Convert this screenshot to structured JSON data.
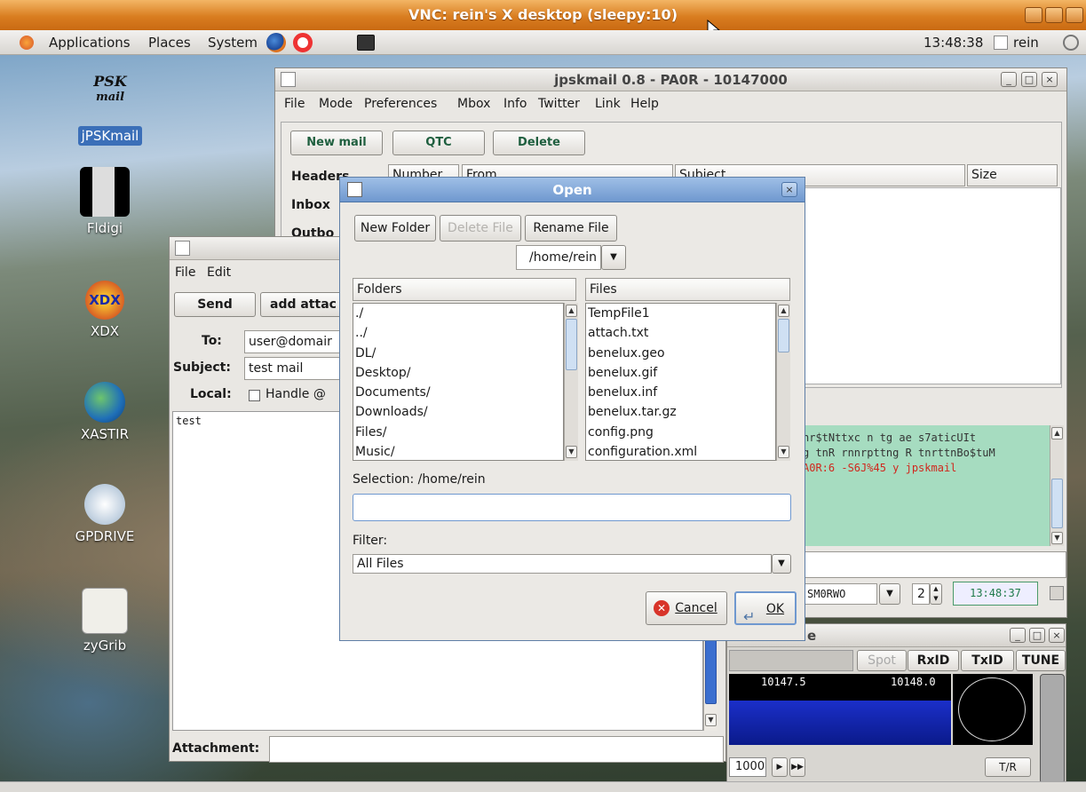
{
  "vnc": {
    "title": "VNC: rein's X desktop (sleepy:10)"
  },
  "panel": {
    "applications": "Applications",
    "places": "Places",
    "system": "System",
    "clock": "13:48:38",
    "user": "rein"
  },
  "desktop_icons": [
    "jPSKmail",
    "Fldigi",
    "XDX",
    "XASTIR",
    "GPDRIVE",
    "zyGrib"
  ],
  "psk_logo": {
    "line1": "PSK",
    "line2": "mail"
  },
  "jpskmail": {
    "title": "jpskmail 0.8 - PA0R - 10147000",
    "menu": [
      "File",
      "Mode",
      "Preferences",
      "Mbox",
      "Info",
      "Twitter",
      "Link",
      "Help"
    ],
    "buttons": {
      "new_mail": "New mail",
      "qtc": "QTC",
      "delete": "Delete"
    },
    "tabs": {
      "headers": "Headers",
      "inbox": "Inbox",
      "outbox": "Outbo"
    },
    "columns": {
      "number": "Number",
      "from": "From",
      "subject": "Subject",
      "size": "Size"
    },
    "terminal_lines": [
      "nr$tNttxc  n tg  ae s7aticUIt",
      "g tnR rnnrpttng R tnrttnBo$tuM",
      "A0R:6 -S6J%45  y jpskmail"
    ],
    "callsign": "SM0RWO",
    "channel": "2",
    "time": "13:48:37"
  },
  "compose": {
    "menu": [
      "File",
      "Edit"
    ],
    "send": "Send",
    "add_attachment": "add attac",
    "to_label": "To:",
    "to_value": "user@domair",
    "subject_label": "Subject:",
    "subject_value": "test mail",
    "local_label": "Local:",
    "handle_label": "Handle @",
    "body": "test",
    "attachment_label": "Attachment:"
  },
  "fldigi": {
    "title_end": "e",
    "spot": "Spot",
    "rxid": "RxID",
    "txid": "TxID",
    "tune": "TUNE",
    "freq1": "10147.5",
    "freq2": "10148.0",
    "wf_freq": "1000",
    "tr": "T/R"
  },
  "open_dialog": {
    "title": "Open",
    "new_folder": "New Folder",
    "delete_file": "Delete File",
    "rename_file": "Rename File",
    "path": "/home/rein",
    "folders_header": "Folders",
    "files_header": "Files",
    "folders": [
      "./",
      "../",
      "DL/",
      "Desktop/",
      "Documents/",
      "Downloads/",
      "Files/",
      "Music/"
    ],
    "files": [
      "TempFile1",
      "attach.txt",
      "benelux.geo",
      "benelux.gif",
      "benelux.inf",
      "benelux.tar.gz",
      "config.png",
      "configuration.xml"
    ],
    "selection_label": "Selection: /home/rein",
    "selection_value": "",
    "filter_label": "Filter:",
    "filter_value": "All Files",
    "cancel": "Cancel",
    "ok": "OK"
  }
}
